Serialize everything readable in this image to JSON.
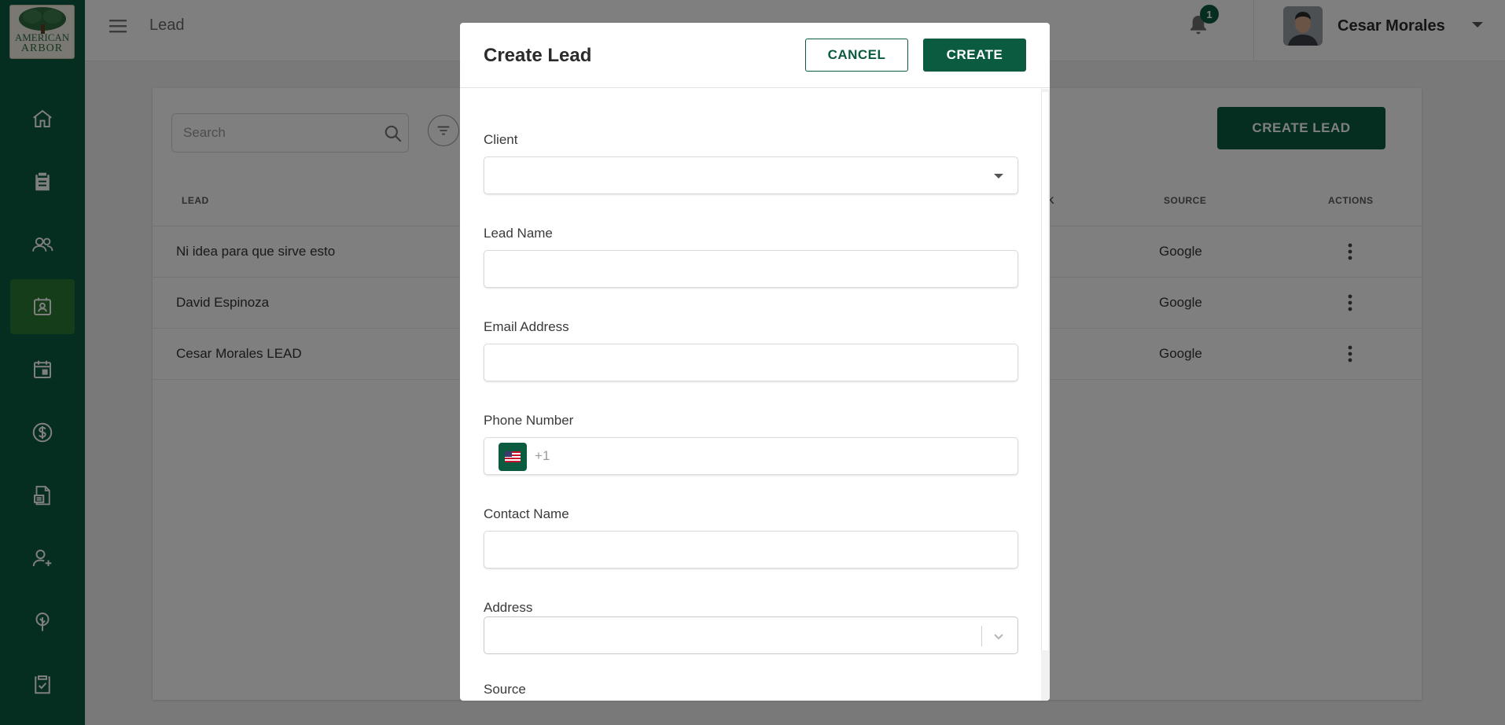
{
  "app": {
    "logo_line1": "AMERICAN",
    "logo_line2": "ARBOR",
    "accent_color": "#0b5b41",
    "active_nav_color": "#2d7a32"
  },
  "sidebar": {
    "items": [
      {
        "icon": "home-icon",
        "active": false
      },
      {
        "icon": "clipboard-icon",
        "active": false
      },
      {
        "icon": "users-icon",
        "active": false
      },
      {
        "icon": "lead-contact-icon",
        "active": true
      },
      {
        "icon": "calendar-icon",
        "active": false
      },
      {
        "icon": "dollar-icon",
        "active": false
      },
      {
        "icon": "invoice-icon",
        "active": false
      },
      {
        "icon": "add-user-icon",
        "active": false
      },
      {
        "icon": "tree-icon",
        "active": false
      },
      {
        "icon": "checklist-icon",
        "active": false
      }
    ]
  },
  "topbar": {
    "page_title": "Lead",
    "notification_count": "1",
    "user_name": "Cesar Morales"
  },
  "toolbar": {
    "search_placeholder": "Search",
    "create_lead_label": "CREATE LEAD"
  },
  "table": {
    "headers": {
      "lead": "LEAD",
      "partial": "K",
      "source": "SOURCE",
      "actions": "ACTIONS"
    },
    "rows": [
      {
        "name": "Ni idea para que sirve esto",
        "source": "Google"
      },
      {
        "name": "David Espinoza",
        "source": "Google"
      },
      {
        "name": "Cesar Morales LEAD",
        "source": "Google"
      }
    ]
  },
  "modal": {
    "title": "Create Lead",
    "cancel_label": "CANCEL",
    "create_label": "CREATE",
    "fields": {
      "client_label": "Client",
      "lead_name_label": "Lead Name",
      "email_label": "Email Address",
      "phone_label": "Phone Number",
      "phone_prefix": "+1",
      "contact_name_label": "Contact Name",
      "address_label": "Address",
      "source_label": "Source"
    }
  }
}
